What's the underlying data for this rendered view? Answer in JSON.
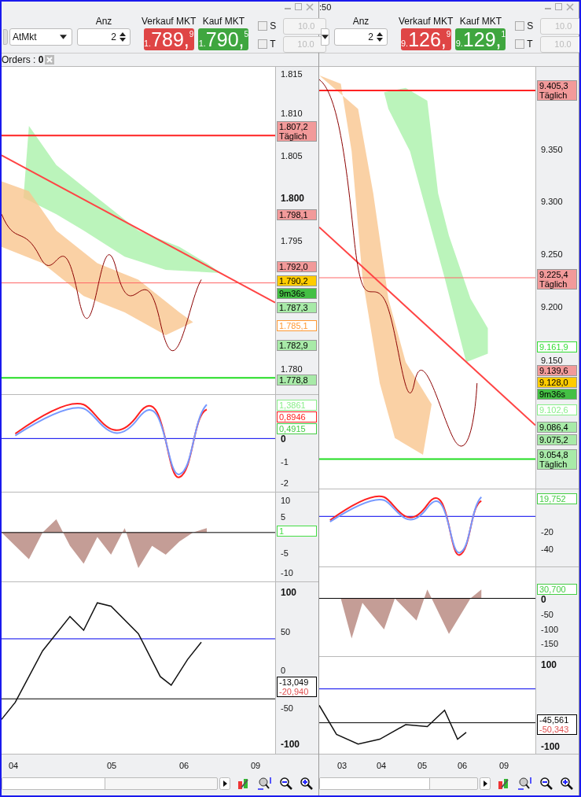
{
  "panels": [
    {
      "order_type": {
        "value": "AtMkt"
      },
      "quantity": {
        "label": "Anz",
        "value": "2"
      },
      "sell": {
        "label": "Verkauf MKT",
        "prefix": "1.",
        "main": "789,",
        "suffix": "9"
      },
      "buy": {
        "label": "Kauf MKT",
        "prefix": "1.",
        "main": "790,",
        "suffix": "5"
      },
      "stop_loss": {
        "label": "S",
        "checked": false,
        "placeholder": "10.0",
        "disabled": true
      },
      "take_profit": {
        "label": "T",
        "checked": false,
        "placeholder": "10.0",
        "disabled": true
      },
      "orders": "Orders : **0**",
      "panes": [
        {
          "kind": "price",
          "ticks": [
            {
              "label": "1.815",
              "bold": false
            },
            {
              "label": "1.810",
              "bold": false
            },
            {
              "label": "1.805",
              "bold": false
            },
            {
              "label": "1.800",
              "bold": true
            },
            {
              "label": "1.795",
              "bold": false
            },
            {
              "label": "1.780",
              "bold": false
            }
          ],
          "tags": [
            {
              "lines": [
                "1.807,2",
                "Täglich"
              ],
              "kind": "filled",
              "color": "#f29a9a"
            },
            {
              "lines": [
                "1.798,1"
              ],
              "kind": "filled",
              "color": "#f29a9a"
            },
            {
              "lines": [
                "1.792,0"
              ],
              "kind": "filled",
              "color": "#f29a9a"
            },
            {
              "lines": [
                "1.790,2"
              ],
              "kind": "filled",
              "color": "#ffcc00"
            },
            {
              "lines": [
                "9m36s"
              ],
              "kind": "filled",
              "color": "#44c044"
            },
            {
              "lines": [
                "1.787,3"
              ],
              "kind": "filled",
              "color": "#a8eaa8"
            },
            {
              "lines": [
                "1.785,1"
              ],
              "kind": "outline",
              "color": "#ff9933"
            },
            {
              "lines": [
                "1.782,9"
              ],
              "kind": "filled",
              "color": "#a8eaa8"
            },
            {
              "lines": [
                "1.778,8"
              ],
              "kind": "filled",
              "color": "#a8eaa8"
            }
          ]
        },
        {
          "kind": "histogram",
          "ticks": [
            {
              "label": "0",
              "bold": true
            },
            {
              "label": "-1",
              "bold": false
            },
            {
              "label": "-2",
              "bold": false
            }
          ],
          "tags": [
            {
              "lines": [
                "1,3861"
              ],
              "kind": "outline",
              "color": "#88ee88"
            },
            {
              "lines": [
                "0,8946"
              ],
              "kind": "outline",
              "color": "#ff2020"
            },
            {
              "lines": [
                "0,4915"
              ],
              "kind": "outline",
              "color": "#44cc44"
            }
          ]
        },
        {
          "kind": "momentum",
          "ticks": [
            {
              "label": "10",
              "bold": false
            },
            {
              "label": "5",
              "bold": false
            },
            {
              "label": "-5",
              "bold": false
            },
            {
              "label": "-10",
              "bold": false
            }
          ],
          "tags": [
            {
              "lines": [
                "1"
              ],
              "kind": "outline",
              "color": "#44dd44"
            }
          ]
        },
        {
          "kind": "oscillator",
          "ticks": [
            {
              "label": "100",
              "bold": true
            },
            {
              "label": "50",
              "bold": false
            },
            {
              "label": "0",
              "bold": false
            },
            {
              "label": "-50",
              "bold": false
            },
            {
              "label": "-100",
              "bold": true
            }
          ],
          "tags": [
            {
              "lines": [
                "-13,049",
                "-20,940"
              ],
              "kind": "outline",
              "color": "#000000"
            }
          ]
        }
      ],
      "x_labels": [
        "04",
        "05",
        "06",
        "09"
      ]
    },
    {
      "title": ":50",
      "quantity": {
        "label": "Anz",
        "value": "2"
      },
      "sell": {
        "label": "Verkauf MKT",
        "prefix": "9.",
        "main": "126,",
        "suffix": "9"
      },
      "buy": {
        "label": "Kauf MKT",
        "prefix": "9.",
        "main": "129,",
        "suffix": "1"
      },
      "stop_loss": {
        "label": "S",
        "checked": false,
        "placeholder": "10.0",
        "disabled": true
      },
      "take_profit": {
        "label": "T",
        "checked": false,
        "placeholder": "10.0",
        "disabled": true
      },
      "panes": [
        {
          "kind": "price",
          "ticks": [
            {
              "label": "9.350",
              "bold": false
            },
            {
              "label": "9.300",
              "bold": false
            },
            {
              "label": "9.250",
              "bold": false
            },
            {
              "label": "9.200",
              "bold": false
            },
            {
              "label": "9.150",
              "bold": false
            }
          ],
          "tags": [
            {
              "lines": [
                "9.405,3",
                "Täglich"
              ],
              "kind": "filled",
              "color": "#f29a9a"
            },
            {
              "lines": [
                "9.225,4",
                "Täglich"
              ],
              "kind": "filled",
              "color": "#f29a9a"
            },
            {
              "lines": [
                "9.161,9"
              ],
              "kind": "outline",
              "color": "#33dd33"
            },
            {
              "lines": [
                "9.139,6"
              ],
              "kind": "filled",
              "color": "#f29a9a"
            },
            {
              "lines": [
                "9.128,0"
              ],
              "kind": "filled",
              "color": "#ffcc00"
            },
            {
              "lines": [
                "9m36s"
              ],
              "kind": "filled",
              "color": "#44c044"
            },
            {
              "lines": [
                "9.102,6"
              ],
              "kind": "outline",
              "color": "#88ee88"
            },
            {
              "lines": [
                "9.086,4"
              ],
              "kind": "filled",
              "color": "#a8eaa8"
            },
            {
              "lines": [
                "9.075,2"
              ],
              "kind": "filled",
              "color": "#a8eaa8"
            },
            {
              "lines": [
                "9.054,8",
                "Täglich"
              ],
              "kind": "filled",
              "color": "#a8eaa8"
            }
          ]
        },
        {
          "kind": "histogram",
          "ticks": [
            {
              "label": "-20",
              "bold": false
            },
            {
              "label": "-40",
              "bold": false
            }
          ],
          "tags": [
            {
              "lines": [
                "19,752"
              ],
              "kind": "outline",
              "color": "#44cc44"
            }
          ]
        },
        {
          "kind": "momentum",
          "ticks": [
            {
              "label": "0",
              "bold": true
            },
            {
              "label": "-50",
              "bold": false
            },
            {
              "label": "-100",
              "bold": false
            },
            {
              "label": "-150",
              "bold": false
            }
          ],
          "tags": [
            {
              "lines": [
                "30,700"
              ],
              "kind": "outline",
              "color": "#44cc44"
            }
          ]
        },
        {
          "kind": "oscillator",
          "ticks": [
            {
              "label": "100",
              "bold": true
            },
            {
              "label": "-100",
              "bold": true
            }
          ],
          "tags": [
            {
              "lines": [
                "-45,561",
                "-50,343"
              ],
              "kind": "outline",
              "color": "#000000"
            }
          ]
        }
      ],
      "x_labels": [
        "03",
        "04",
        "05",
        "06",
        "09"
      ]
    }
  ]
}
